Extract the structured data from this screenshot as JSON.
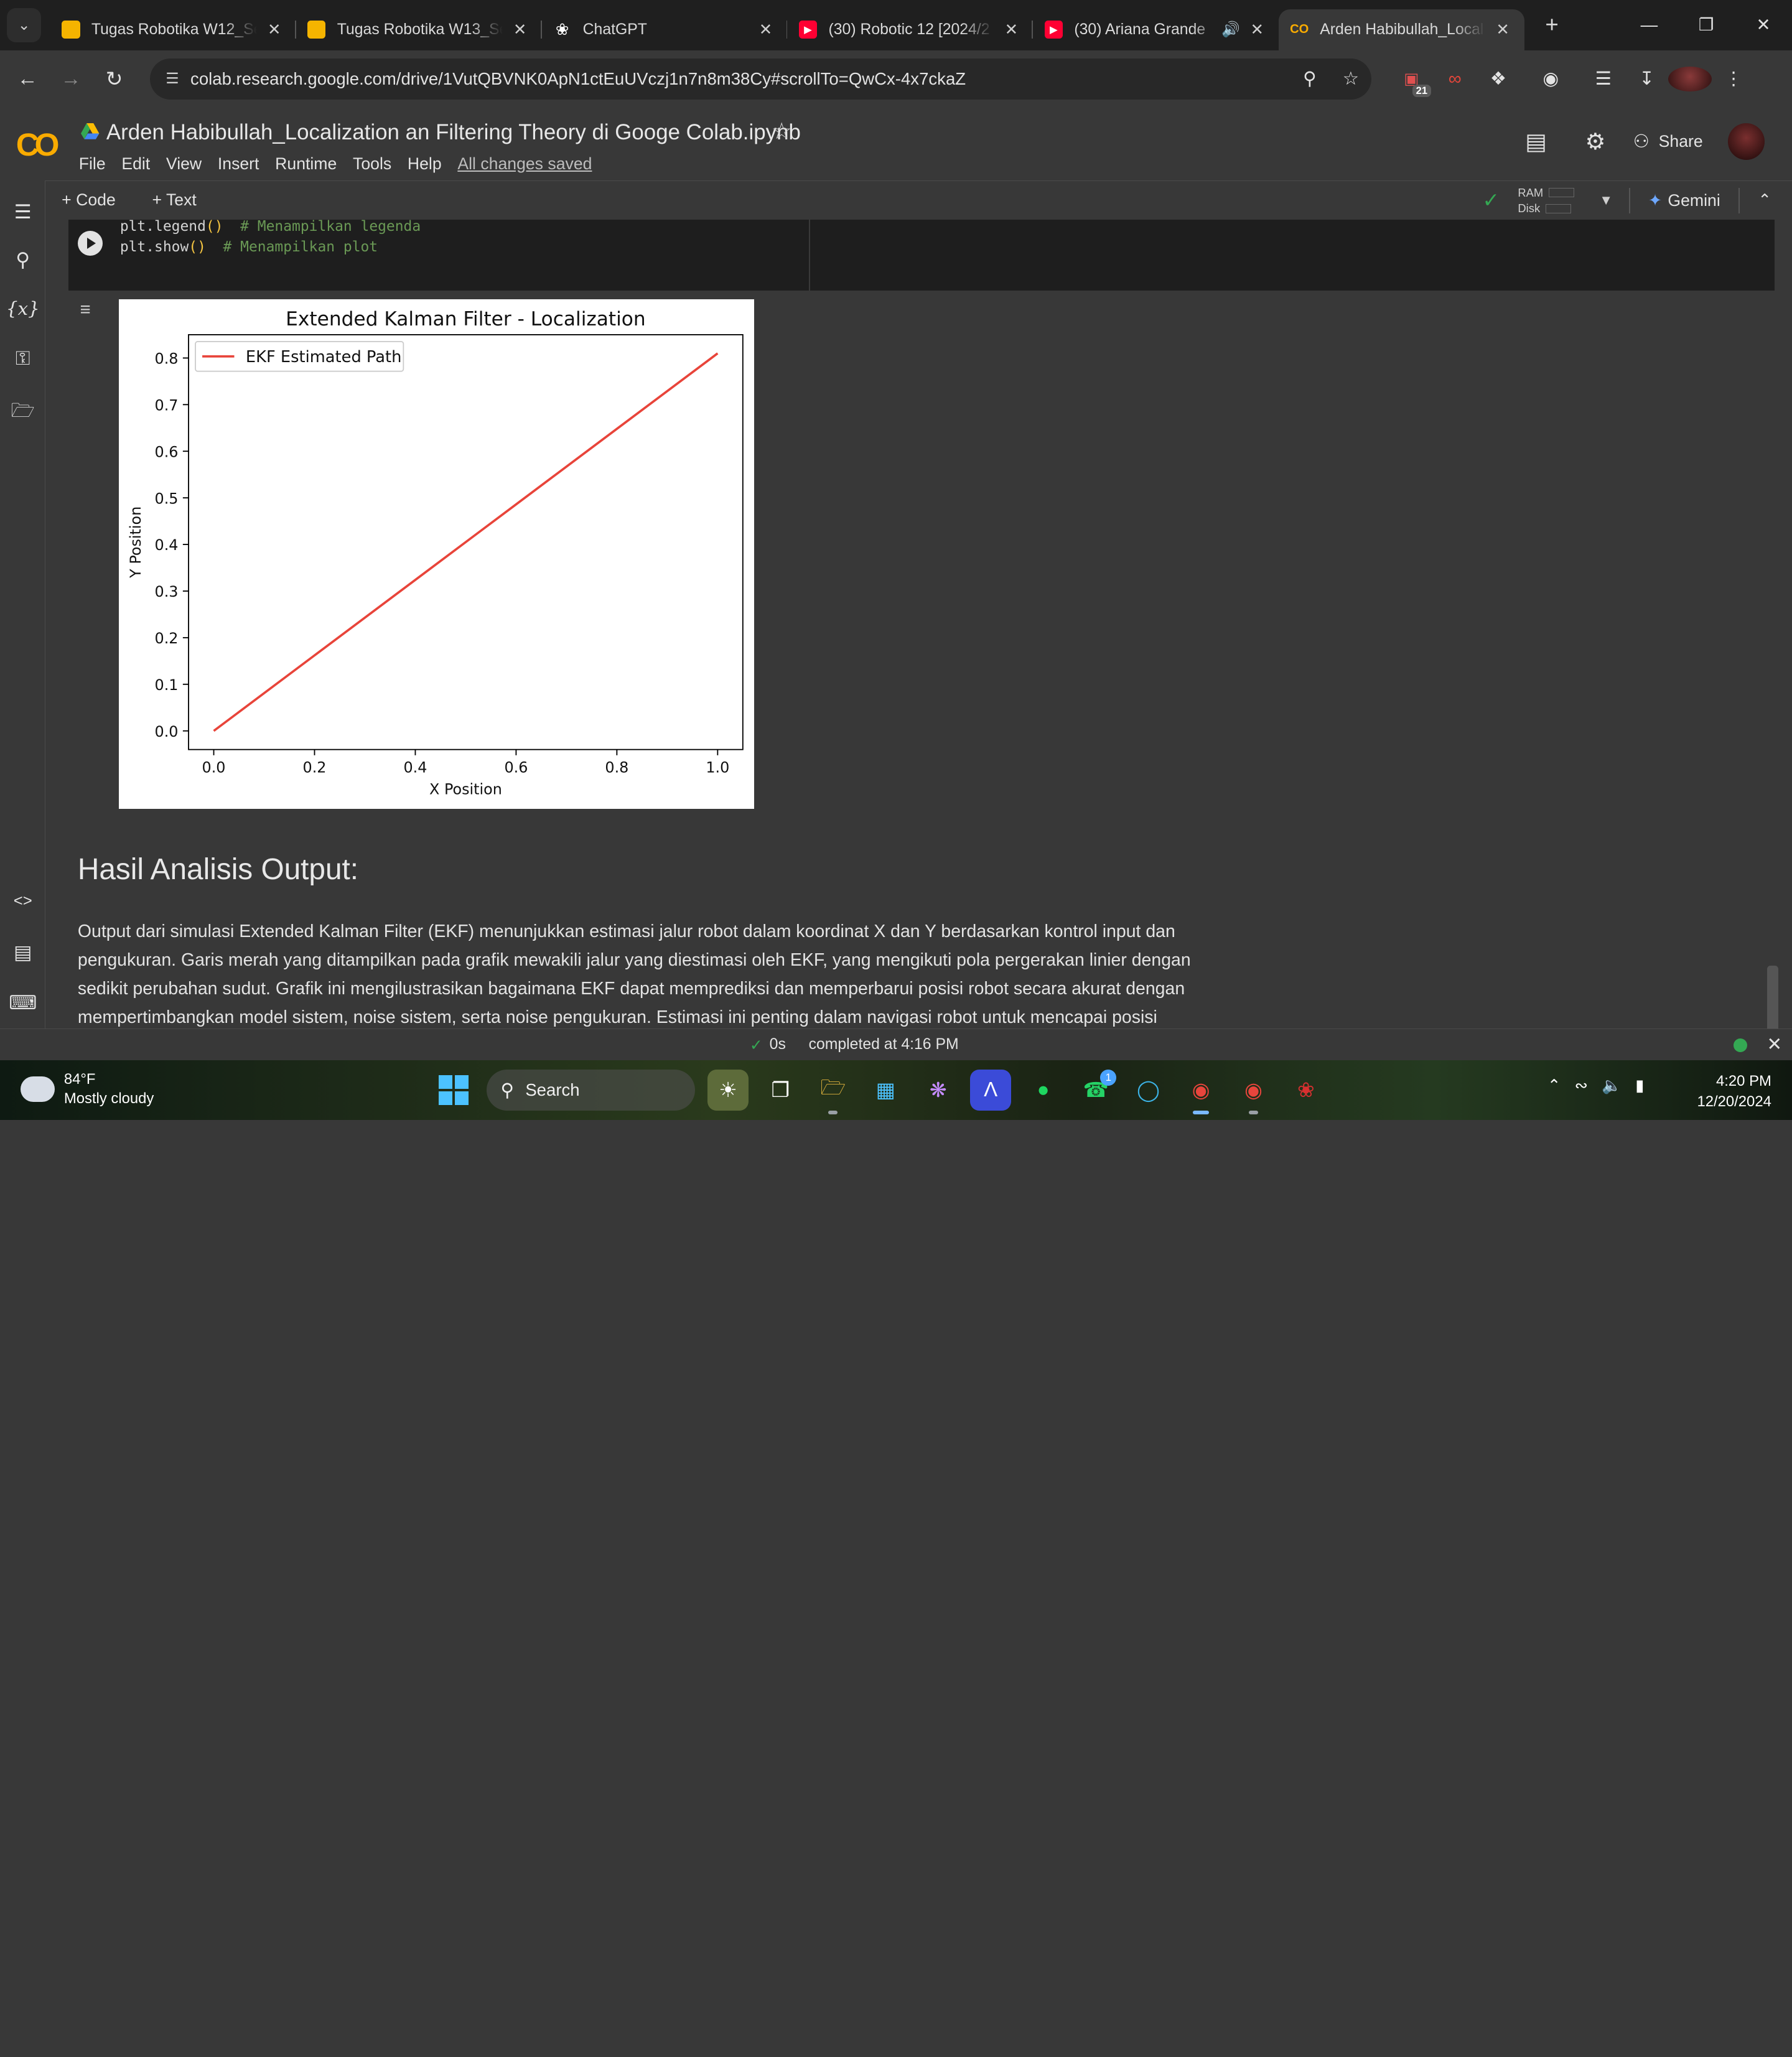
{
  "browser": {
    "tabs": [
      {
        "title": "Tugas Robotika W12_Se",
        "favicon": "slides-icon",
        "color": "#f5b400",
        "active": false
      },
      {
        "title": "Tugas Robotika W13_Se",
        "favicon": "slides-icon",
        "color": "#f5b400",
        "active": false
      },
      {
        "title": "ChatGPT",
        "favicon": "chatgpt-icon",
        "color": "#ffffff",
        "active": false
      },
      {
        "title": "(30) Robotic 12 [2024/2",
        "favicon": "youtube-icon",
        "color": "#ff0033",
        "active": false
      },
      {
        "title": "(30) Ariana Grande",
        "favicon": "youtube-icon",
        "color": "#ff0033",
        "active": false
      },
      {
        "title": "Arden Habibullah_Local",
        "favicon": "colab-icon",
        "color": "#f9ab00",
        "active": true
      }
    ],
    "url": "colab.research.google.com/drive/1VutQBVNK0ApN1ctEuUVczj1n7n8m38Cy#scrollTo=QwCx-4x7ckaZ",
    "extension_badge": "21"
  },
  "colab": {
    "logo": "CO",
    "notebook_title": "Arden Habibullah_Localization an Filtering Theory di Googe Colab.ipynb",
    "menu": [
      "File",
      "Edit",
      "View",
      "Insert",
      "Runtime",
      "Tools",
      "Help"
    ],
    "save_status": "All changes saved",
    "share_label": "Share",
    "toolbar": {
      "add_code": "Code",
      "add_text": "Text",
      "ram": "RAM",
      "disk": "Disk",
      "gemini": "Gemini"
    }
  },
  "cell": {
    "line1_code": "plt.legend",
    "line1_comment": "# Menampilkan legenda",
    "line2_code": "plt.show",
    "line2_comment": "# Menampilkan plot"
  },
  "chart_data": {
    "type": "line",
    "title": "Extended Kalman Filter - Localization",
    "xlabel": "X Position",
    "ylabel": "Y Position",
    "xlim": [
      -0.05,
      1.05
    ],
    "ylim": [
      -0.04,
      0.85
    ],
    "xticks": [
      "0.0",
      "0.2",
      "0.4",
      "0.6",
      "0.8",
      "1.0"
    ],
    "yticks": [
      "0.0",
      "0.1",
      "0.2",
      "0.3",
      "0.4",
      "0.5",
      "0.6",
      "0.7",
      "0.8"
    ],
    "legend_position": "top-left",
    "grid": false,
    "series": [
      {
        "name": "EKF Estimated Path",
        "color": "#e8443a",
        "x": [
          0.0,
          0.2,
          0.4,
          0.6,
          0.8,
          1.0
        ],
        "y": [
          0.0,
          0.162,
          0.324,
          0.486,
          0.648,
          0.81
        ]
      }
    ]
  },
  "markdown": {
    "heading": "Hasil Analisis Output:",
    "paragraph": "Output dari simulasi Extended Kalman Filter (EKF) menunjukkan estimasi jalur robot dalam koordinat X dan Y berdasarkan kontrol input dan pengukuran. Garis merah yang ditampilkan pada grafik mewakili jalur yang diestimasi oleh EKF, yang mengikuti pola pergerakan linier dengan sedikit perubahan sudut. Grafik ini mengilustrasikan bagaimana EKF dapat memprediksi dan memperbarui posisi robot secara akurat dengan mempertimbangkan model sistem, noise sistem, serta noise pengukuran. Estimasi ini penting dalam navigasi robot untuk mencapai posisi"
  },
  "status": {
    "duration": "0s",
    "message": "completed at 4:16 PM"
  },
  "taskbar": {
    "temperature": "84°F",
    "condition": "Mostly cloudy",
    "search_label": "Search",
    "whatsapp_badge": "1",
    "time": "4:20 PM",
    "date": "12/20/2024"
  }
}
